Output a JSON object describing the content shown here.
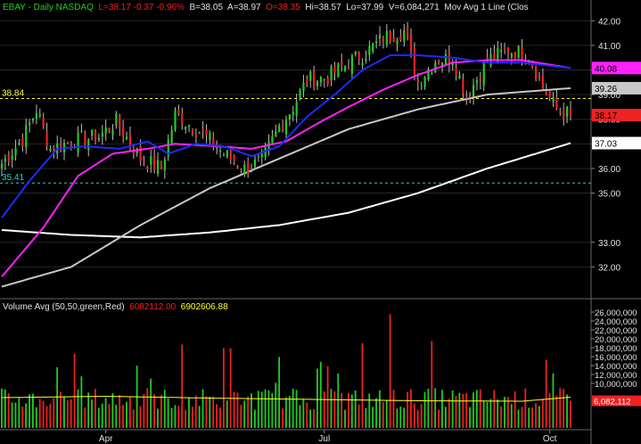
{
  "header": {
    "symbol": "EBAY - Daily  NASDAQ",
    "low_change": "L=38.17  -0.37  -0.96%",
    "bid": "B=38.05",
    "ask": "A=38.97",
    "open": "O=38.35",
    "high": "Hi=38.57",
    "lo": "Lo=37.99",
    "volume": "V=6,084,271",
    "ma_label": "Mov Avg 1 Line (Clos"
  },
  "volume_header": {
    "label": "Volume Avg (50,50,green,Red)",
    "value1": "6082112.00",
    "value2": "6902606.88"
  },
  "colors": {
    "up": "#22cc22",
    "down": "#ee2222",
    "ma20": "#1c2cff",
    "ma50": "#ff22ff",
    "ma100": "#c8c8c8",
    "ma200": "#ffffff",
    "support": "#22cccc",
    "resistance": "#ffff33",
    "vol_avg": "#ffff22"
  },
  "chart_data": {
    "type": "candlestick",
    "price_axis": {
      "ylim": [
        31.0,
        42.3
      ],
      "ticks": [
        "32.00",
        "33.00",
        "35.00",
        "36.00",
        "37.00",
        "38.00",
        "39.00",
        "40.00",
        "41.00",
        "42.00"
      ]
    },
    "volume_axis": {
      "ylim": [
        0,
        27000000
      ],
      "ticks": [
        "10,000,000",
        "12,000,000",
        "14,000,000",
        "16,000,000",
        "18,000,000",
        "20,000,000",
        "22,000,000",
        "24,000,000",
        "26,000,000"
      ]
    },
    "x_ticks": [
      "Apr",
      "Jul",
      "Oct"
    ],
    "x_tick_index": [
      30,
      93,
      158
    ],
    "n_bars": 165,
    "ma_labels": [
      {
        "text": "40.08",
        "value": 40.08,
        "bg": "#ff22ff",
        "fg": "#000000"
      },
      {
        "text": "39.26",
        "value": 39.26,
        "bg": "#c8c8c8",
        "fg": "#000000"
      },
      {
        "text": "38.17",
        "value": 38.17,
        "bg": "#ee2222",
        "fg": "#000000"
      },
      {
        "text": "37.03",
        "value": 37.03,
        "bg": "#ffffff",
        "fg": "#000000"
      }
    ],
    "support_line": {
      "value": 35.41,
      "label": "35.41"
    },
    "resistance_line": {
      "value": 38.84,
      "label": "38.84"
    },
    "volume_tags": [
      {
        "text": "6,082,112",
        "bg": "#ee2222",
        "fg": "#ffffff"
      }
    ],
    "close_anchors": [
      [
        0,
        36.2
      ],
      [
        6,
        37.2
      ],
      [
        10,
        38.4
      ],
      [
        14,
        36.8
      ],
      [
        20,
        37.1
      ],
      [
        28,
        37.3
      ],
      [
        33,
        37.9
      ],
      [
        40,
        36.4
      ],
      [
        46,
        36.0
      ],
      [
        50,
        38.2
      ],
      [
        57,
        37.5
      ],
      [
        64,
        36.6
      ],
      [
        70,
        36.0
      ],
      [
        75,
        36.3
      ],
      [
        80,
        37.7
      ],
      [
        84,
        38.5
      ],
      [
        88,
        39.6
      ],
      [
        94,
        39.7
      ],
      [
        100,
        40.3
      ],
      [
        105,
        40.7
      ],
      [
        110,
        41.3
      ],
      [
        116,
        41.6
      ],
      [
        120,
        39.5
      ],
      [
        125,
        40.4
      ],
      [
        130,
        40.5
      ],
      [
        134,
        38.9
      ],
      [
        140,
        40.4
      ],
      [
        146,
        40.8
      ],
      [
        152,
        40.6
      ],
      [
        156,
        39.3
      ],
      [
        160,
        38.4
      ],
      [
        164,
        38.17
      ]
    ],
    "ma20_anchors": [
      [
        0,
        34.0
      ],
      [
        8,
        35.5
      ],
      [
        16,
        36.8
      ],
      [
        24,
        36.9
      ],
      [
        34,
        36.8
      ],
      [
        42,
        37.1
      ],
      [
        48,
        36.6
      ],
      [
        56,
        37.0
      ],
      [
        64,
        36.9
      ],
      [
        72,
        36.5
      ],
      [
        80,
        36.9
      ],
      [
        88,
        38.1
      ],
      [
        96,
        39.0
      ],
      [
        104,
        40.0
      ],
      [
        112,
        40.6
      ],
      [
        120,
        40.6
      ],
      [
        130,
        40.5
      ],
      [
        140,
        40.3
      ],
      [
        150,
        40.3
      ],
      [
        164,
        40.08
      ]
    ],
    "ma50_anchors": [
      [
        0,
        31.6
      ],
      [
        12,
        33.6
      ],
      [
        22,
        35.7
      ],
      [
        32,
        36.6
      ],
      [
        42,
        36.8
      ],
      [
        50,
        37.0
      ],
      [
        62,
        36.9
      ],
      [
        72,
        36.8
      ],
      [
        82,
        37.1
      ],
      [
        92,
        37.9
      ],
      [
        100,
        38.5
      ],
      [
        110,
        39.2
      ],
      [
        120,
        39.8
      ],
      [
        130,
        40.3
      ],
      [
        140,
        40.4
      ],
      [
        150,
        40.4
      ],
      [
        164,
        40.08
      ]
    ],
    "ma100_anchors": [
      [
        0,
        31.2
      ],
      [
        20,
        32.0
      ],
      [
        40,
        33.7
      ],
      [
        60,
        35.2
      ],
      [
        80,
        36.4
      ],
      [
        100,
        37.6
      ],
      [
        120,
        38.4
      ],
      [
        140,
        39.0
      ],
      [
        164,
        39.26
      ]
    ],
    "ma200_anchors": [
      [
        0,
        33.5
      ],
      [
        20,
        33.3
      ],
      [
        40,
        33.2
      ],
      [
        60,
        33.4
      ],
      [
        80,
        33.7
      ],
      [
        100,
        34.2
      ],
      [
        120,
        35.0
      ],
      [
        140,
        36.0
      ],
      [
        164,
        37.03
      ]
    ],
    "vol_avg_anchors": [
      [
        0,
        6800000
      ],
      [
        30,
        7100000
      ],
      [
        60,
        6700000
      ],
      [
        90,
        6400000
      ],
      [
        120,
        6100000
      ],
      [
        150,
        6000000
      ],
      [
        164,
        6900000
      ]
    ]
  }
}
